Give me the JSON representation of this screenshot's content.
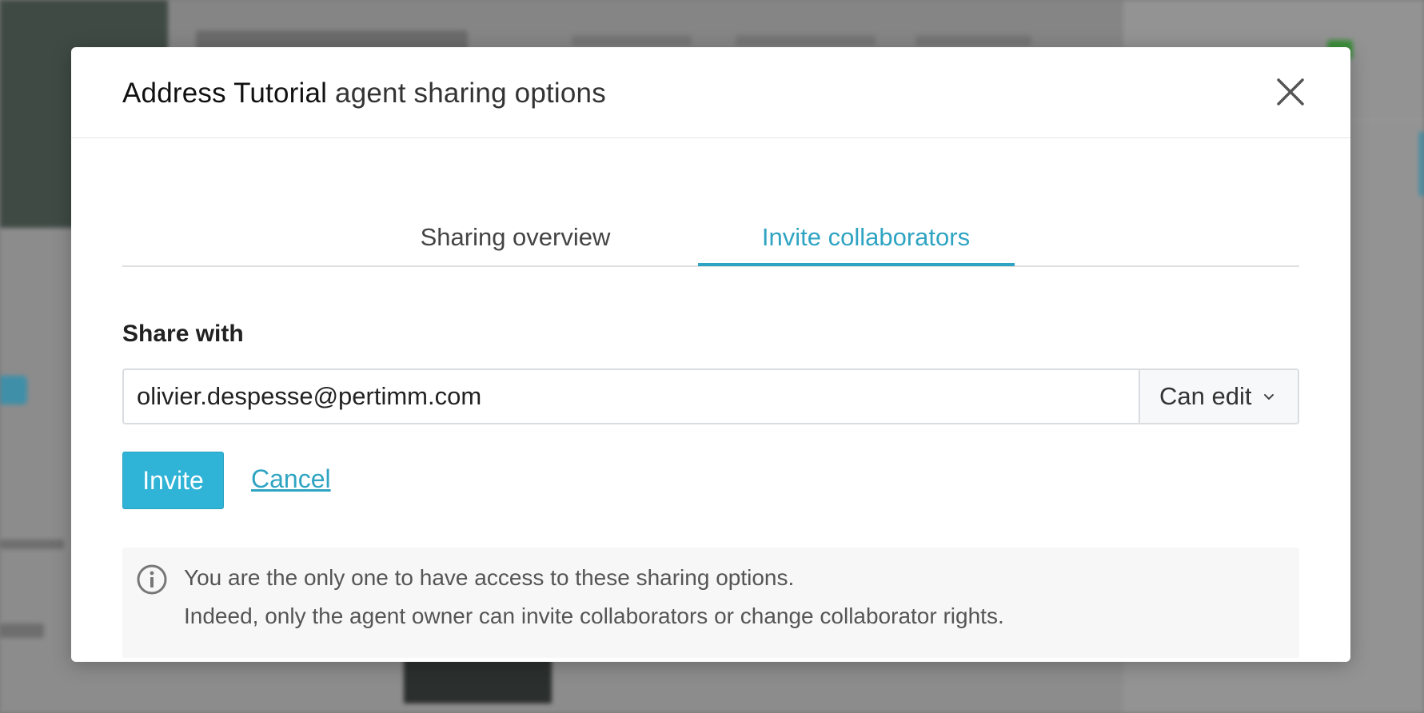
{
  "dialog": {
    "agent_name": "Address Tutorial",
    "title_suffix": " agent sharing options",
    "close_icon": "close-icon"
  },
  "tabs": [
    {
      "label": "Sharing overview",
      "active": false
    },
    {
      "label": "Invite collaborators",
      "active": true
    }
  ],
  "form": {
    "share_label": "Share with",
    "email_value": "olivier.despesse@pertimm.com",
    "rights_selected": "Can edit",
    "invite_label": "Invite",
    "cancel_label": "Cancel"
  },
  "info": {
    "icon": "info-icon",
    "line1": "You are the only one to have access to these sharing options.",
    "line2": "Indeed, only the agent owner can invite collaborators or change collaborator rights."
  },
  "colors": {
    "accent": "#2fa4c2",
    "button": "#2fb3d6",
    "info_bg": "#f7f7f7",
    "overlay": "#7a7a7a"
  }
}
